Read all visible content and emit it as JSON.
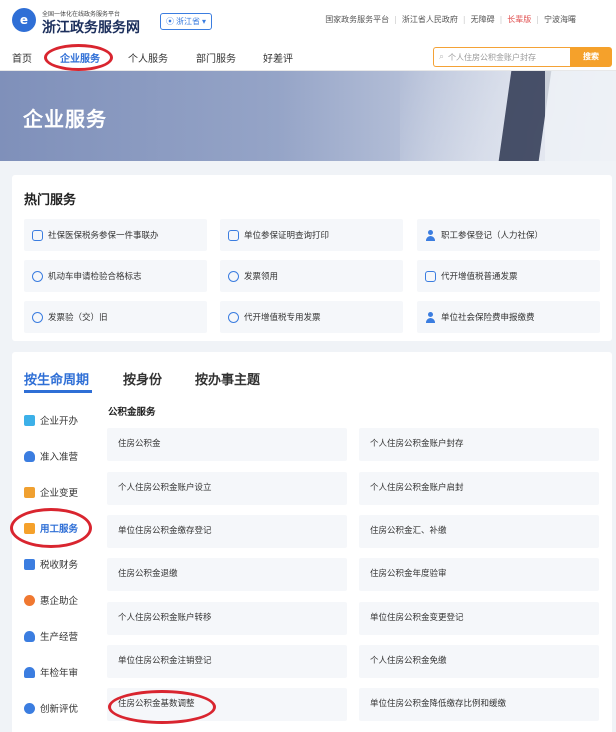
{
  "header": {
    "logo_subtitle": "全国一体化在线政务服务平台",
    "logo_title": "浙江政务服务网",
    "region": "浙江省",
    "top_links": [
      "国家政务服务平台",
      "浙江省人民政府",
      "无障碍",
      "长辈版",
      "宁波海曙"
    ]
  },
  "nav": {
    "items": [
      "首页",
      "企业服务",
      "个人服务",
      "部门服务",
      "好差评"
    ],
    "active": "企业服务",
    "search_placeholder": "个人住房公积金账户封存",
    "search_button": "搜索"
  },
  "banner": {
    "title": "企业服务"
  },
  "hot_services": {
    "title": "热门服务",
    "items": [
      {
        "label": "社保医保税务参保一件事联办",
        "icon": "shield-icon"
      },
      {
        "label": "单位参保证明查询打印",
        "icon": "printer-icon"
      },
      {
        "label": "职工参保登记（人力社保）",
        "icon": "user-icon"
      },
      {
        "label": "机动车申请检验合格标志",
        "icon": "car-icon"
      },
      {
        "label": "发票领用",
        "icon": "invoice-icon"
      },
      {
        "label": "代开增值税普通发票",
        "icon": "id-card-icon"
      },
      {
        "label": "发票验（交）旧",
        "icon": "invoice-check-icon"
      },
      {
        "label": "代开增值税专用发票",
        "icon": "invoice-special-icon"
      },
      {
        "label": "单位社会保险费申报缴费",
        "icon": "user-icon"
      }
    ]
  },
  "lifecycle": {
    "tabs": [
      "按生命周期",
      "按身份",
      "按办事主题"
    ],
    "sidebar": [
      {
        "label": "企业开办",
        "color": "#3cb0e8"
      },
      {
        "label": "准入准营",
        "color": "#3b7de0"
      },
      {
        "label": "企业变更",
        "color": "#f0a030"
      },
      {
        "label": "用工服务",
        "color": "#f5a12b"
      },
      {
        "label": "税收财务",
        "color": "#3b7de0"
      },
      {
        "label": "惠企助企",
        "color": "#f07830"
      },
      {
        "label": "生产经营",
        "color": "#3b7de0"
      },
      {
        "label": "年检年审",
        "color": "#3b7de0"
      },
      {
        "label": "创新评优",
        "color": "#3b7de0"
      }
    ],
    "active_sidebar": "用工服务",
    "group_title": "公积金服务",
    "services": [
      "住房公积金",
      "个人住房公积金账户封存",
      "个人住房公积金账户设立",
      "个人住房公积金账户启封",
      "单位住房公积金缴存登记",
      "住房公积金汇、补缴",
      "住房公积金退缴",
      "住房公积金年度验审",
      "个人住房公积金账户转移",
      "单位住房公积金变更登记",
      "单位住房公积金注销登记",
      "个人住房公积金免缴",
      "住房公积金基数调整",
      "单位住房公积金降低缴存比例和缓缴"
    ]
  }
}
